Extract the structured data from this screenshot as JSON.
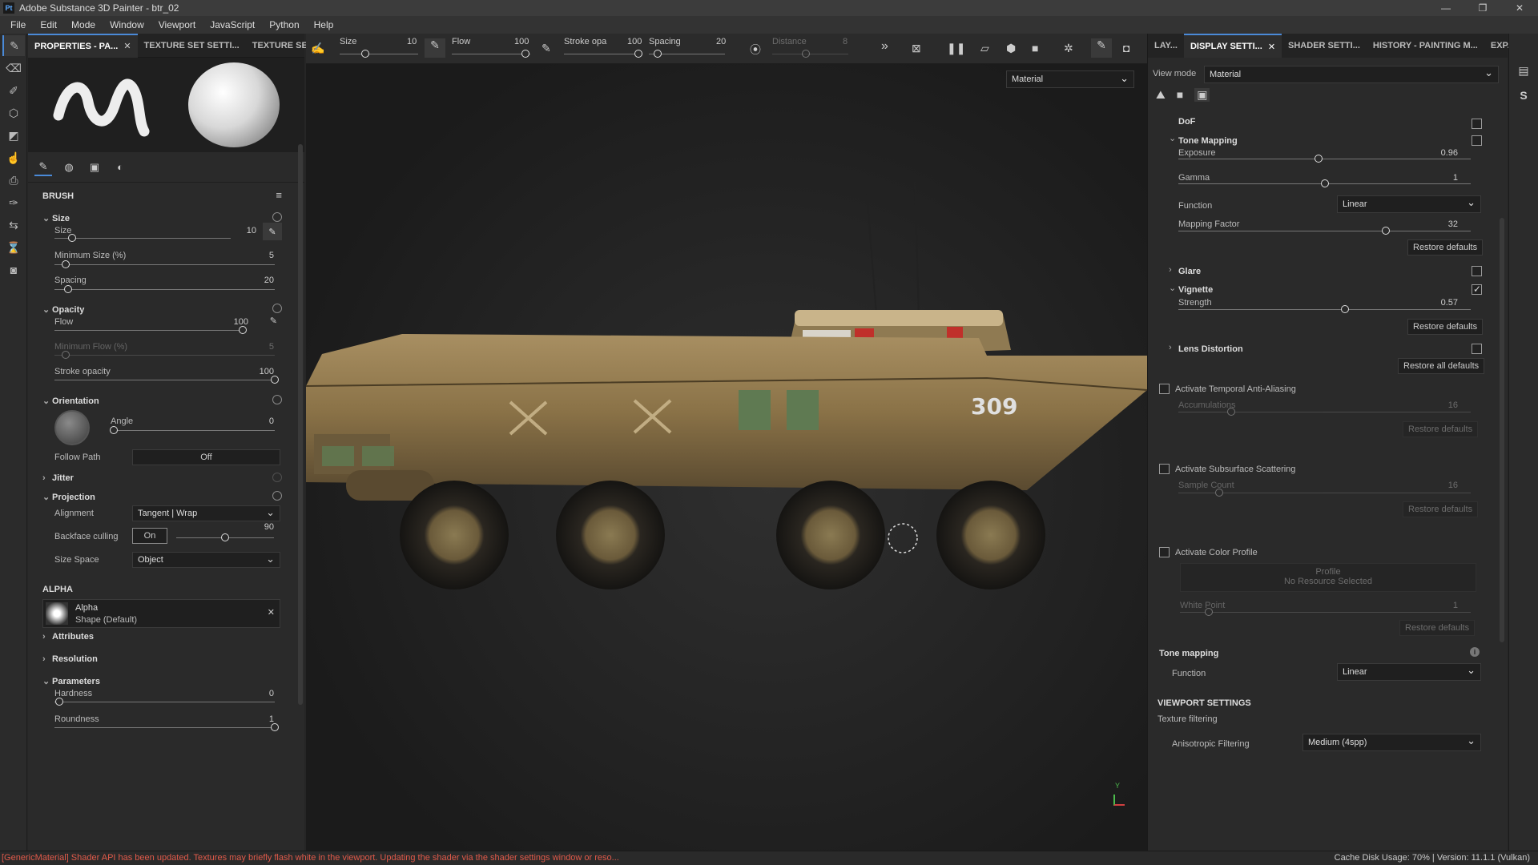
{
  "app": {
    "logo": "Pt",
    "title": "Adobe Substance 3D Painter - btr_02",
    "min": "—",
    "max": "❐",
    "close": "✕"
  },
  "menu": [
    "File",
    "Edit",
    "Mode",
    "Window",
    "Viewport",
    "JavaScript",
    "Python",
    "Help"
  ],
  "tools": [
    "brush-icon",
    "eraser-icon",
    "projection-icon",
    "geometry-mask-icon",
    "polygon-fill-icon",
    "smudge-icon",
    "clone-icon",
    "picker-icon",
    "bake-icon",
    "measure-icon",
    "color-picker-icon"
  ],
  "left_tabs": [
    {
      "label": "PROPERTIES - PA...",
      "close": "✕"
    },
    {
      "label": "TEXTURE SET SETTI..."
    },
    {
      "label": "TEXTURE SET ..."
    }
  ],
  "left_icons": [
    "brush-tab",
    "material-tab",
    "stencil-tab",
    "alpha-tab"
  ],
  "brush": {
    "section": "BRUSH",
    "size": {
      "group": "Size",
      "label": "Size",
      "value": "10",
      "frac": 0.1
    },
    "min_size": {
      "label": "Minimum Size (%)",
      "value": "5",
      "frac": 0.05
    },
    "spacing": {
      "label": "Spacing",
      "value": "20",
      "frac": 0.06
    },
    "opacity": {
      "group": "Opacity",
      "flow_label": "Flow",
      "flow_value": "100",
      "flow_frac": 1,
      "min_flow_label": "Minimum Flow (%)",
      "min_flow_value": "5",
      "stroke_label": "Stroke opacity",
      "stroke_value": "100"
    },
    "orientation": {
      "group": "Orientation",
      "angle_label": "Angle",
      "angle_value": "0",
      "follow_label": "Follow Path",
      "follow_value": "Off"
    },
    "jitter": "Jitter",
    "projection": {
      "group": "Projection",
      "alignment_label": "Alignment",
      "alignment_value": "Tangent | Wrap",
      "backface_label": "Backface culling",
      "backface_value": "On",
      "backface_num": "90",
      "size_space_label": "Size Space",
      "size_space_value": "Object"
    }
  },
  "alpha": {
    "section": "ALPHA",
    "name": "Alpha",
    "sub": "Shape (Default)",
    "close": "✕",
    "attributes": "Attributes",
    "resolution": "Resolution",
    "parameters": "Parameters",
    "hardness_label": "Hardness",
    "hardness_value": "0",
    "roundness_label": "Roundness",
    "roundness_value": "1"
  },
  "toolbar": {
    "size_label": "Size",
    "size_value": "10",
    "flow_label": "Flow",
    "flow_value": "100",
    "stroke_label": "Stroke opa",
    "stroke_value": "100",
    "spacing_label": "Spacing",
    "spacing_value": "20",
    "distance_label": "Distance",
    "distance_value": "8",
    "more": "»"
  },
  "viewport": {
    "mode": "Material",
    "badge": "309",
    "axis_label": "Y"
  },
  "right_tabs": [
    {
      "label": "LAY..."
    },
    {
      "label": "DISPLAY SETTI...",
      "close": "✕"
    },
    {
      "label": "SHADER SETTI..."
    },
    {
      "label": "HISTORY - PAINTING M..."
    },
    {
      "label": "EXP..."
    }
  ],
  "display": {
    "view_mode_label": "View mode",
    "view_mode_value": "Material",
    "dof": "DoF",
    "tone_mapping": {
      "label": "Tone Mapping",
      "exposure_label": "Exposure",
      "exposure_value": "0.96",
      "exposure_frac": 0.48,
      "gamma_label": "Gamma",
      "gamma_value": "1",
      "gamma_frac": 0.5,
      "function_label": "Function",
      "function_value": "Linear",
      "mapping_label": "Mapping Factor",
      "mapping_value": "32",
      "mapping_frac": 0.71,
      "restore": "Restore defaults"
    },
    "glare": "Glare",
    "vignette": {
      "label": "Vignette",
      "strength_label": "Strength",
      "strength_value": "0.57",
      "strength_frac": 0.57,
      "restore": "Restore defaults"
    },
    "lens": "Lens Distortion",
    "restore_all": "Restore all defaults",
    "taa": {
      "label": "Activate Temporal Anti-Aliasing",
      "acc_label": "Accumulations",
      "acc_value": "16",
      "restore": "Restore defaults"
    },
    "sss": {
      "label": "Activate Subsurface Scattering",
      "sample_label": "Sample Count",
      "sample_value": "16",
      "restore": "Restore defaults"
    },
    "color_profile": {
      "label": "Activate Color Profile",
      "profile": "Profile",
      "profile_sub": "No Resource Selected",
      "white_label": "White Point",
      "white_value": "1",
      "restore": "Restore defaults"
    },
    "tone_mapping2": {
      "label": "Tone mapping",
      "function_label": "Function",
      "function_value": "Linear"
    },
    "viewport_settings": {
      "label": "VIEWPORT SETTINGS",
      "texture_filtering": "Texture filtering",
      "aniso_label": "Anisotropic Filtering",
      "aniso_value": "Medium (4spp)"
    }
  },
  "status": {
    "error": "[GenericMaterial] Shader API has been updated. Textures may briefly flash white in the viewport. Updating the shader via the shader settings window or reso...",
    "right": "Cache Disk Usage:   70% | Version: 11.1.1 (Vulkan)"
  }
}
